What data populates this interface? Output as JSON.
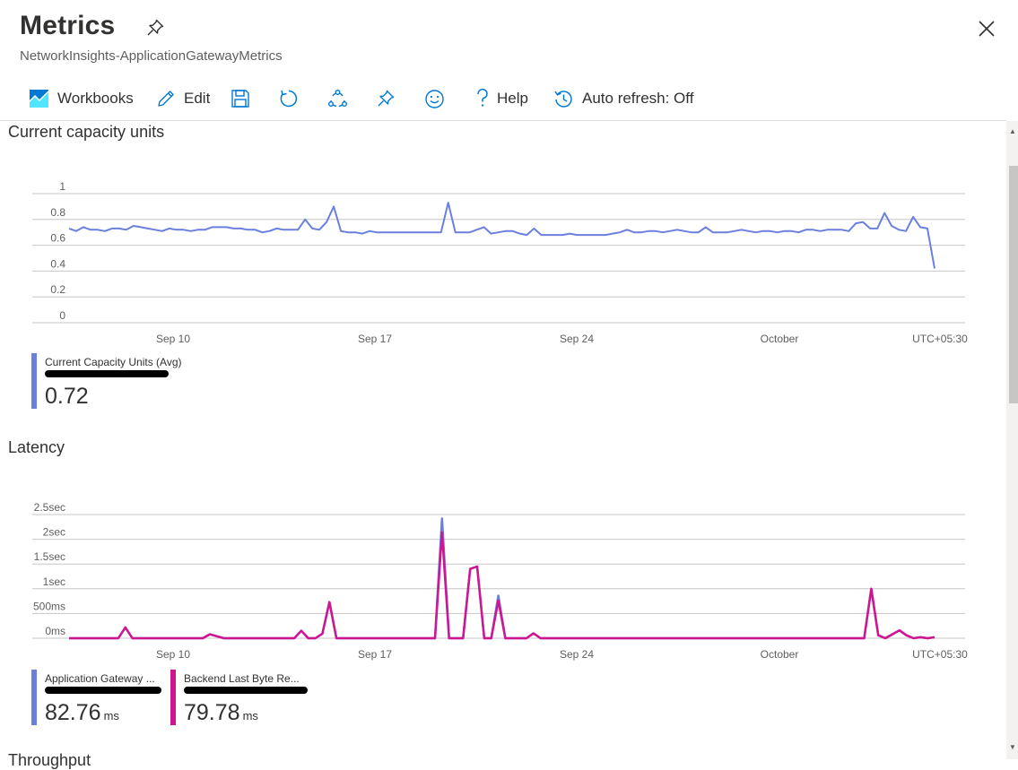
{
  "header": {
    "title": "Metrics",
    "subtitle": "NetworkInsights-ApplicationGatewayMetrics"
  },
  "toolbar": {
    "workbooks_label": "Workbooks",
    "edit_label": "Edit",
    "help_label": "Help",
    "auto_refresh_label": "Auto refresh: Off"
  },
  "colors": {
    "capacity_series": "#6b7fe0",
    "latency_total_series": "#6b7fe0",
    "latency_backend_series": "#d01590",
    "accent": "#0078d4"
  },
  "capacity_section": {
    "title": "Current capacity units",
    "legend": {
      "name": "Current Capacity Units (Avg)",
      "value": "0.72"
    }
  },
  "latency_section": {
    "title": "Latency",
    "legend": [
      {
        "name": "Application Gateway ...",
        "value": "82.76",
        "unit": "ms"
      },
      {
        "name": "Backend Last Byte Re...",
        "value": "79.78",
        "unit": "ms"
      }
    ]
  },
  "next_section": {
    "title": "Throughput"
  },
  "chart_data": [
    {
      "type": "line",
      "title": "Current capacity units",
      "y_ticks": [
        "1",
        "0.8",
        "0.6",
        "0.4",
        "0.2",
        "0"
      ],
      "x_ticks": [
        "Sep 10",
        "Sep 17",
        "Sep 24",
        "October",
        "UTC+05:30"
      ],
      "ylim": [
        0,
        1
      ],
      "grid": true,
      "series": [
        {
          "name": "Current Capacity Units (Avg)",
          "values": [
            0.73,
            0.71,
            0.74,
            0.72,
            0.72,
            0.71,
            0.73,
            0.73,
            0.72,
            0.75,
            0.74,
            0.73,
            0.72,
            0.71,
            0.73,
            0.72,
            0.72,
            0.71,
            0.72,
            0.72,
            0.74,
            0.74,
            0.74,
            0.73,
            0.73,
            0.72,
            0.72,
            0.7,
            0.71,
            0.73,
            0.72,
            0.72,
            0.72,
            0.8,
            0.73,
            0.72,
            0.78,
            0.9,
            0.71,
            0.7,
            0.7,
            0.69,
            0.71,
            0.7,
            0.7,
            0.7,
            0.7,
            0.7,
            0.7,
            0.7,
            0.7,
            0.7,
            0.7,
            0.93,
            0.7,
            0.7,
            0.7,
            0.72,
            0.74,
            0.69,
            0.7,
            0.71,
            0.71,
            0.69,
            0.68,
            0.73,
            0.68,
            0.68,
            0.68,
            0.68,
            0.69,
            0.68,
            0.68,
            0.68,
            0.68,
            0.68,
            0.69,
            0.7,
            0.72,
            0.7,
            0.7,
            0.71,
            0.71,
            0.7,
            0.71,
            0.72,
            0.71,
            0.7,
            0.7,
            0.74,
            0.7,
            0.7,
            0.7,
            0.71,
            0.72,
            0.71,
            0.7,
            0.71,
            0.71,
            0.7,
            0.71,
            0.71,
            0.7,
            0.72,
            0.72,
            0.71,
            0.72,
            0.72,
            0.72,
            0.71,
            0.77,
            0.78,
            0.73,
            0.73,
            0.85,
            0.75,
            0.72,
            0.71,
            0.82,
            0.74,
            0.73,
            0.42
          ]
        }
      ]
    },
    {
      "type": "line",
      "title": "Latency",
      "y_ticks": [
        "2.5sec",
        "2sec",
        "1.5sec",
        "1sec",
        "500ms",
        "0ms"
      ],
      "x_ticks": [
        "Sep 10",
        "Sep 17",
        "Sep 24",
        "October",
        "UTC+05:30"
      ],
      "ylim_ms": [
        0,
        2500
      ],
      "grid": true,
      "series": [
        {
          "name": "Application Gateway ...",
          "values_ms": [
            0,
            0,
            0,
            0,
            0,
            0,
            0,
            0,
            220,
            0,
            0,
            0,
            0,
            0,
            0,
            0,
            0,
            0,
            0,
            0,
            80,
            40,
            0,
            0,
            0,
            0,
            0,
            0,
            0,
            0,
            0,
            0,
            0,
            150,
            0,
            0,
            90,
            730,
            0,
            0,
            0,
            0,
            0,
            0,
            0,
            0,
            0,
            0,
            0,
            0,
            0,
            0,
            0,
            2420,
            0,
            0,
            0,
            1400,
            1450,
            0,
            0,
            860,
            0,
            0,
            0,
            0,
            100,
            0,
            0,
            0,
            0,
            0,
            0,
            0,
            0,
            0,
            0,
            0,
            0,
            0,
            0,
            0,
            0,
            0,
            0,
            0,
            0,
            0,
            0,
            0,
            0,
            0,
            0,
            0,
            0,
            0,
            0,
            0,
            0,
            0,
            0,
            0,
            0,
            0,
            0,
            0,
            0,
            0,
            0,
            0,
            0,
            0,
            0,
            0,
            1000,
            60,
            0,
            80,
            160,
            60,
            0,
            20,
            0,
            20
          ]
        },
        {
          "name": "Backend Last Byte Re...",
          "values_ms": [
            0,
            0,
            0,
            0,
            0,
            0,
            0,
            0,
            220,
            0,
            0,
            0,
            0,
            0,
            0,
            0,
            0,
            0,
            0,
            0,
            80,
            40,
            0,
            0,
            0,
            0,
            0,
            0,
            0,
            0,
            0,
            0,
            0,
            150,
            0,
            0,
            90,
            730,
            0,
            0,
            0,
            0,
            0,
            0,
            0,
            0,
            0,
            0,
            0,
            0,
            0,
            0,
            0,
            2140,
            0,
            0,
            0,
            1400,
            1450,
            0,
            0,
            760,
            0,
            0,
            0,
            0,
            100,
            0,
            0,
            0,
            0,
            0,
            0,
            0,
            0,
            0,
            0,
            0,
            0,
            0,
            0,
            0,
            0,
            0,
            0,
            0,
            0,
            0,
            0,
            0,
            0,
            0,
            0,
            0,
            0,
            0,
            0,
            0,
            0,
            0,
            0,
            0,
            0,
            0,
            0,
            0,
            0,
            0,
            0,
            0,
            0,
            0,
            0,
            0,
            1000,
            60,
            0,
            80,
            160,
            60,
            0,
            20,
            0,
            20
          ]
        }
      ]
    }
  ]
}
